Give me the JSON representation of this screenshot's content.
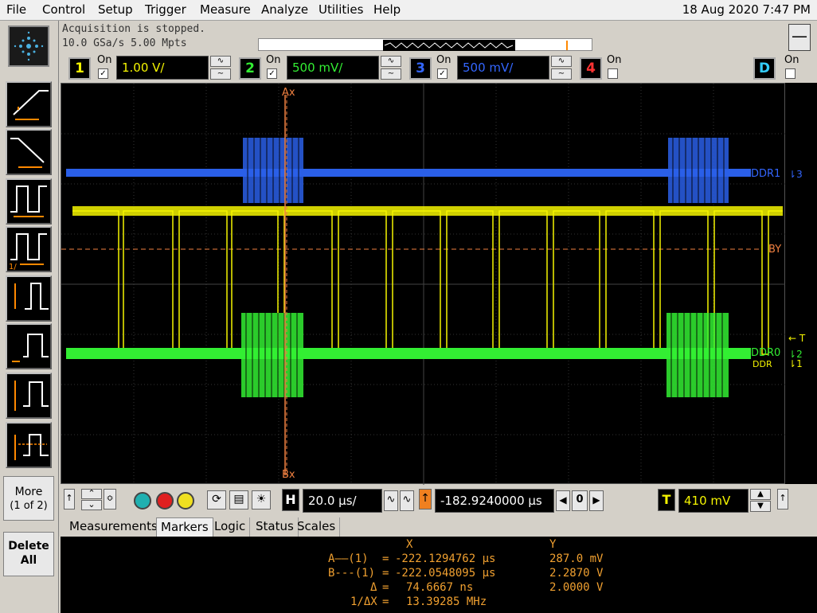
{
  "menu": [
    "File",
    "Control",
    "Setup",
    "Trigger",
    "Measure",
    "Analyze",
    "Utilities",
    "Help"
  ],
  "datetime": "18 Aug 2020  7:47 PM",
  "status": {
    "line1": "Acquisition is stopped.",
    "line2": "10.0 GSa/s   5.00 Mpts"
  },
  "channels": [
    {
      "num": "1",
      "on_label": "On",
      "checked": true,
      "scale": "1.00 V/",
      "color": "#f5f500"
    },
    {
      "num": "2",
      "on_label": "On",
      "checked": true,
      "scale": "500 mV/",
      "color": "#33ee33"
    },
    {
      "num": "3",
      "on_label": "On",
      "checked": true,
      "scale": "500 mV/",
      "color": "#3366ff"
    },
    {
      "num": "4",
      "on_label": "On",
      "checked": false,
      "scale": "",
      "color": "#ff3333"
    },
    {
      "num": "D",
      "on_label": "On",
      "checked": false,
      "scale": "",
      "color": "#33ccff"
    }
  ],
  "screen": {
    "marker_ax": "Ax",
    "marker_bx": "Bx",
    "marker_by": "BY",
    "label_ddr1": "DDR1",
    "label_ddr0": "DDR0",
    "label_ddr0_shadow": "DDR",
    "ch3_marker": "3",
    "ch2_marker": "2",
    "ch1_marker": "1",
    "trig_marker": "T"
  },
  "left_buttons": {
    "more_label": "More",
    "more_page": "(1 of 2)",
    "delete_label": "Delete",
    "delete_label2": "All"
  },
  "controls": {
    "hscale": "20.0 µs/",
    "hpos": "-182.9240000 µs",
    "zoom_value": "0",
    "trig_label": "T",
    "trig_level": "410 mV",
    "h_label": "H"
  },
  "tabs": [
    "Measurements",
    "Markers",
    "Logic",
    "Status",
    "Scales"
  ],
  "active_tab": "Markers",
  "readout": {
    "header_x": "X",
    "header_y": "Y",
    "rows": [
      {
        "label": "A——(1)",
        "x": "-222.1294762 µs",
        "y": "287.0 mV"
      },
      {
        "label": "B---(1)",
        "x": "-222.0548095 µs",
        "y": "2.2870 V"
      },
      {
        "label": "Δ",
        "x": "74.6667 ns",
        "y": "2.0000 V"
      },
      {
        "label": "1/ΔX",
        "x": "13.39285 MHz",
        "y": ""
      }
    ]
  }
}
